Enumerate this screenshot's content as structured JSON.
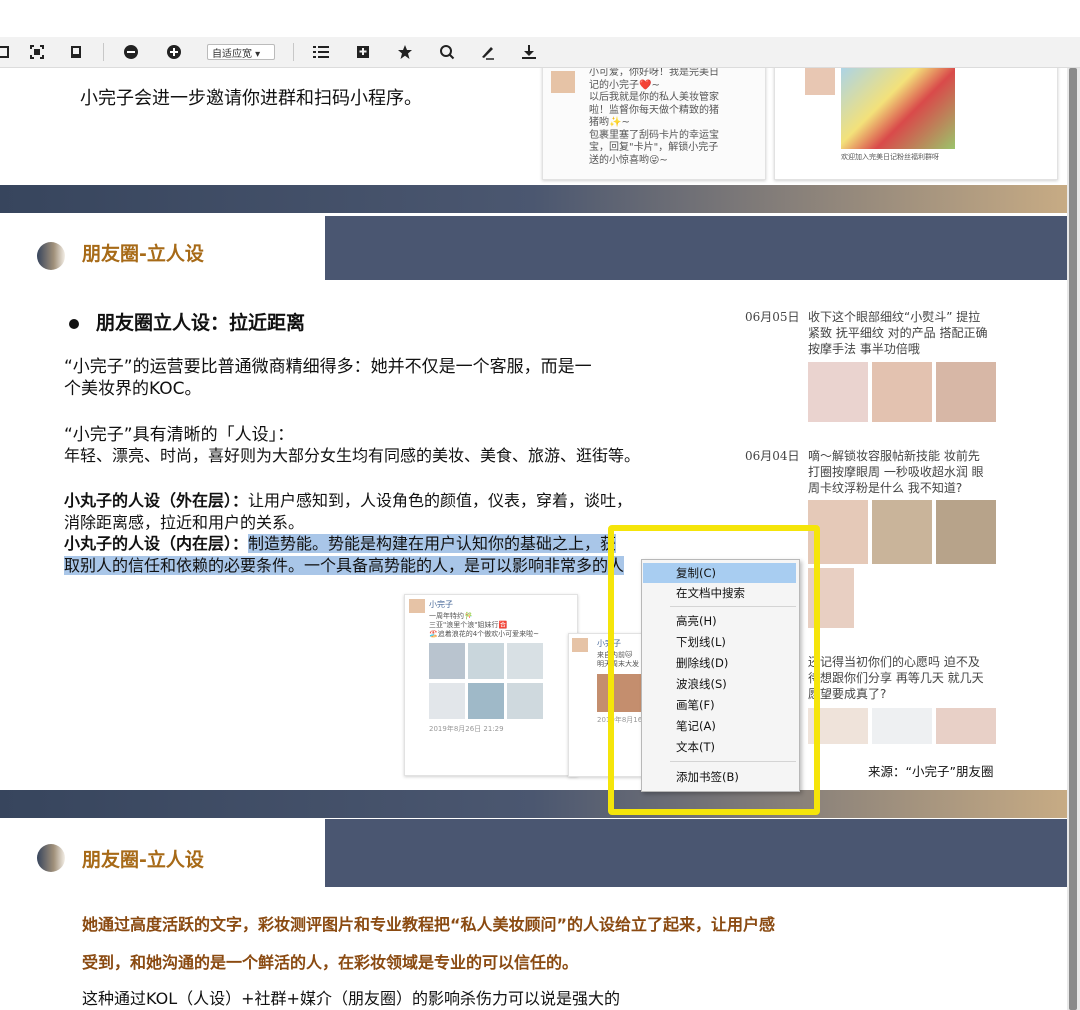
{
  "toolbar": {
    "zoom_label": "自适应宽 ▾",
    "icons": [
      "select-icon",
      "fullscreen-icon",
      "fit-page-icon",
      "zoom-out-icon",
      "zoom-in-icon",
      "list-icon",
      "bookmark-add-icon",
      "star-icon",
      "search-icon",
      "pen-icon",
      "download-icon"
    ]
  },
  "top": {
    "intro_text": "小完子会进一步邀请你进群和扫码小程序。",
    "chat_lines": [
      "小可爱，你好呀！我是完美日",
      "记的小完子❤️~",
      "以后我就是你的私人美妆管家",
      "啦！监督你每天做个精致的猪",
      "猪哟✨~",
      "包裹里塞了刮码卡片的幸运宝",
      "宝，回复\"卡片\"，解锁小完子",
      "送的小惊喜哟😜~"
    ],
    "group_caption": "欢迎加入完美日记粉丝福利群呀"
  },
  "section1": {
    "title": "朋友圈-立人设",
    "bullet_heading": "朋友圈立人设：拉近距离",
    "para1": [
      "“小完子”的运营要比普通微商精细得多：她并不仅是一个客服，而是一",
      "个美妆界的KOC。"
    ],
    "para2_line1": "“小完子”具有清晰的「人设」：",
    "para2_line2": "年轻、漂亮、时尚，喜好则为大部分女生均有同感的美妆、美食、旅游、逛街等。",
    "outer_label": "小丸子的人设（外在层）：",
    "outer_text": "让用户感知到，人设角色的颜值，仪表，穿着，谈吐，",
    "outer_text2": "消除距离感，拉近和用户的关系。",
    "inner_label": "小丸子的人设（内在层）：",
    "inner_text": "制造势能。势能是构建在用户认知你的基础之上，获",
    "inner_text2": "取别人的信任和依赖的必要条件。一个具备高势能的人，是可以影响非常多的人",
    "moment1": {
      "name": "小完子",
      "line1": "一周年特约🎋",
      "line2": "三亚\"浪里个浪\"姐妹行🈴",
      "line3": "🏖️追着浪花的4个傲欢小可爱来啦~",
      "date": "2019年8月26日 21:29"
    },
    "moment2": {
      "name": "小完子",
      "line1": "来自内前🐱",
      "line2": "明天周末大发",
      "date": "2019年8月16日"
    },
    "right_posts": [
      {
        "date": "06月05日",
        "lines": [
          "收下这个眼部细纹“小熨斗” 提拉",
          "紧致 抚平细纹 对的产品 搭配正确",
          "按摩手法 事半功倍哦"
        ]
      },
      {
        "date": "06月04日",
        "lines": [
          "嘀～解锁妆容服帖新技能 妆前先",
          "打圈按摩眼周 一秒吸收超水润 眼",
          "周卡纹浮粉是什么 我不知道?"
        ]
      }
    ],
    "right_post3": [
      "还记得当初你们的心愿吗 迫不及",
      "待想跟你们分享 再等几天 就几天",
      "愿望要成真了?"
    ],
    "source": "来源：“小完子”朋友圈"
  },
  "context_menu": {
    "items": [
      "复制(C)",
      "在文档中搜索",
      "高亮(H)",
      "下划线(L)",
      "删除线(D)",
      "波浪线(S)",
      "画笔(F)",
      "笔记(A)",
      "文本(T)",
      "添加书签(B)"
    ]
  },
  "section2": {
    "title": "朋友圈-立人设",
    "bold_line1": "她通过高度活跃的文字，彩妆测评图片和专业教程把“私人美妆顾问”的人设给立了起来，让用户感",
    "bold_line2": "受到，和她沟通的是一个鲜活的人，在彩妆领域是专业的可以信任的。",
    "line3": "这种通过KOL（人设）+社群+媒介（朋友圈）的影响杀伤力可以说是强大的"
  },
  "colors": {
    "accent_gold": "#a76a17",
    "band_navy": "#4a5671",
    "highlight": "#a9c6e8",
    "annotation_yellow": "#f5e50a"
  }
}
